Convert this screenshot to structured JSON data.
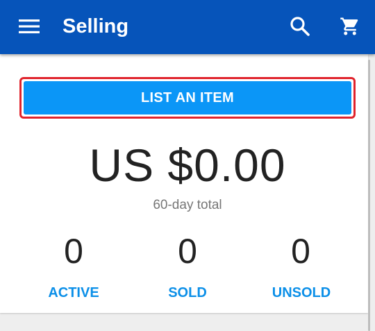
{
  "app_bar": {
    "title": "Selling",
    "menu_icon": "hamburger-menu-icon",
    "search_icon": "search-icon",
    "cart_icon": "shopping-cart-icon",
    "background_color": "#0654ba"
  },
  "main": {
    "list_item_button_label": "LIST AN ITEM",
    "total_amount": "US $0.00",
    "total_label": "60-day total",
    "stats": [
      {
        "value": "0",
        "label": "ACTIVE"
      },
      {
        "value": "0",
        "label": "SOLD"
      },
      {
        "value": "0",
        "label": "UNSOLD"
      }
    ],
    "accent_color": "#0b96f7",
    "highlight_border_color": "#e0232c"
  }
}
